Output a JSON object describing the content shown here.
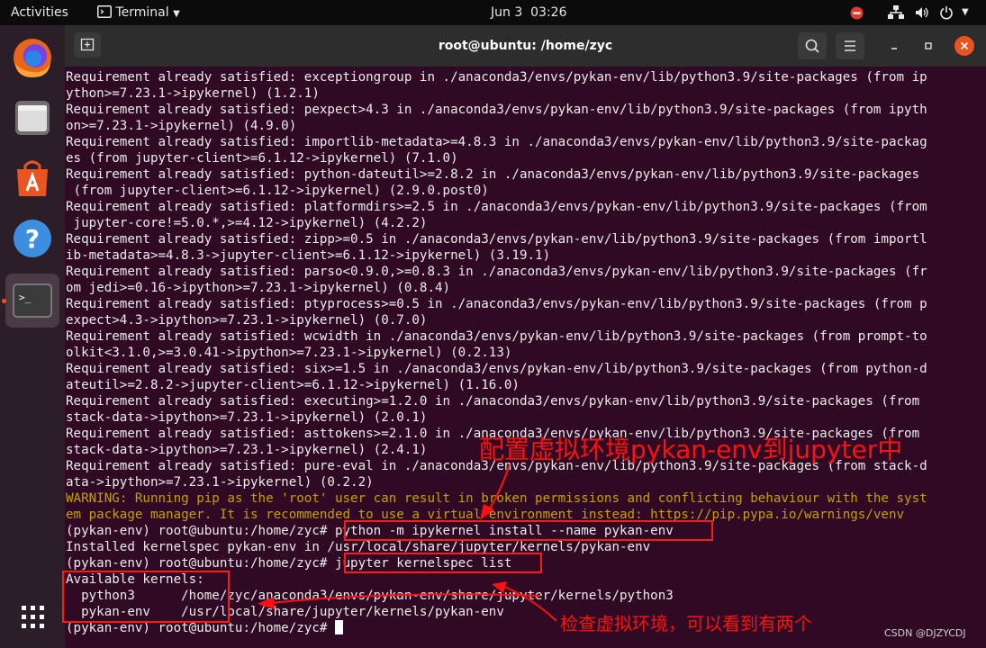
{
  "topbar": {
    "activities": "Activities",
    "app_name": "Terminal",
    "date": "Jun 3",
    "time": "03:26"
  },
  "window": {
    "title": "root@ubuntu: /home/zyc"
  },
  "dock": {
    "items": [
      "Firefox",
      "Files",
      "Ubuntu Software",
      "Help",
      "Terminal"
    ],
    "apps_grid": "Show Applications"
  },
  "terminal": {
    "lines": [
      {
        "text": "Requirement already satisfied: exceptiongroup in ./anaconda3/envs/pykan-env/lib/python3.9/site-packages (from ip",
        "type": "normal"
      },
      {
        "text": "ython>=7.23.1->ipykernel) (1.2.1)",
        "type": "normal"
      },
      {
        "text": "Requirement already satisfied: pexpect>4.3 in ./anaconda3/envs/pykan-env/lib/python3.9/site-packages (from ipyth",
        "type": "normal"
      },
      {
        "text": "on>=7.23.1->ipykernel) (4.9.0)",
        "type": "normal"
      },
      {
        "text": "Requirement already satisfied: importlib-metadata>=4.8.3 in ./anaconda3/envs/pykan-env/lib/python3.9/site-packag",
        "type": "normal"
      },
      {
        "text": "es (from jupyter-client>=6.1.12->ipykernel) (7.1.0)",
        "type": "normal"
      },
      {
        "text": "Requirement already satisfied: python-dateutil>=2.8.2 in ./anaconda3/envs/pykan-env/lib/python3.9/site-packages",
        "type": "normal"
      },
      {
        "text": " (from jupyter-client>=6.1.12->ipykernel) (2.9.0.post0)",
        "type": "normal"
      },
      {
        "text": "Requirement already satisfied: platformdirs>=2.5 in ./anaconda3/envs/pykan-env/lib/python3.9/site-packages (from",
        "type": "normal"
      },
      {
        "text": " jupyter-core!=5.0.*,>=4.12->ipykernel) (4.2.2)",
        "type": "normal"
      },
      {
        "text": "Requirement already satisfied: zipp>=0.5 in ./anaconda3/envs/pykan-env/lib/python3.9/site-packages (from importl",
        "type": "normal"
      },
      {
        "text": "ib-metadata>=4.8.3->jupyter-client>=6.1.12->ipykernel) (3.19.1)",
        "type": "normal"
      },
      {
        "text": "Requirement already satisfied: parso<0.9.0,>=0.8.3 in ./anaconda3/envs/pykan-env/lib/python3.9/site-packages (fr",
        "type": "normal"
      },
      {
        "text": "om jedi>=0.16->ipython>=7.23.1->ipykernel) (0.8.4)",
        "type": "normal"
      },
      {
        "text": "Requirement already satisfied: ptyprocess>=0.5 in ./anaconda3/envs/pykan-env/lib/python3.9/site-packages (from p",
        "type": "normal"
      },
      {
        "text": "expect>4.3->ipython>=7.23.1->ipykernel) (0.7.0)",
        "type": "normal"
      },
      {
        "text": "Requirement already satisfied: wcwidth in ./anaconda3/envs/pykan-env/lib/python3.9/site-packages (from prompt-to",
        "type": "normal"
      },
      {
        "text": "olkit<3.1.0,>=3.0.41->ipython>=7.23.1->ipykernel) (0.2.13)",
        "type": "normal"
      },
      {
        "text": "Requirement already satisfied: six>=1.5 in ./anaconda3/envs/pykan-env/lib/python3.9/site-packages (from python-d",
        "type": "normal"
      },
      {
        "text": "ateutil>=2.8.2->jupyter-client>=6.1.12->ipykernel) (1.16.0)",
        "type": "normal"
      },
      {
        "text": "Requirement already satisfied: executing>=1.2.0 in ./anaconda3/envs/pykan-env/lib/python3.9/site-packages (from",
        "type": "normal"
      },
      {
        "text": "stack-data->ipython>=7.23.1->ipykernel) (2.0.1)",
        "type": "normal"
      },
      {
        "text": "Requirement already satisfied: asttokens>=2.1.0 in ./anaconda3/envs/pykan-env/lib/python3.9/site-packages (from",
        "type": "normal"
      },
      {
        "text": "stack-data->ipython>=7.23.1->ipykernel) (2.4.1)",
        "type": "normal"
      },
      {
        "text": "Requirement already satisfied: pure-eval in ./anaconda3/envs/pykan-env/lib/python3.9/site-packages (from stack-d",
        "type": "normal"
      },
      {
        "text": "ata->ipython>=7.23.1->ipykernel) (0.2.2)",
        "type": "normal"
      },
      {
        "text": "WARNING: Running pip as the 'root' user can result in broken permissions and conflicting behaviour with the syst",
        "type": "warn"
      },
      {
        "text": "em package manager. It is recommended to use a virtual environment instead: https://pip.pypa.io/warnings/venv",
        "type": "warn"
      },
      {
        "text": "(pykan-env) root@ubuntu:/home/zyc# python -m ipykernel install --name pykan-env",
        "type": "prompt"
      },
      {
        "text": "Installed kernelspec pykan-env in /usr/local/share/jupyter/kernels/pykan-env",
        "type": "normal"
      },
      {
        "text": "(pykan-env) root@ubuntu:/home/zyc# jupyter kernelspec list",
        "type": "prompt"
      },
      {
        "text": "Available kernels:",
        "type": "normal"
      },
      {
        "text": "  python3      /home/zyc/anaconda3/envs/pykan-env/share/jupyter/kernels/python3",
        "type": "normal"
      },
      {
        "text": "  pykan-env    /usr/local/share/jupyter/kernels/pykan-env",
        "type": "normal"
      },
      {
        "text": "(pykan-env) root@ubuntu:/home/zyc# ",
        "type": "prompt"
      }
    ]
  },
  "annotations": {
    "top": "配置虚拟环境pykan-env到jupyter中",
    "bottom": "检查虚拟环境，可以看到有两个"
  },
  "watermark": "CSDN @DJZYCDJ",
  "colors": {
    "terminal_bg": "#300a24",
    "warning": "#c4a000",
    "annotation": "#ff1010",
    "accent": "#e95420"
  }
}
